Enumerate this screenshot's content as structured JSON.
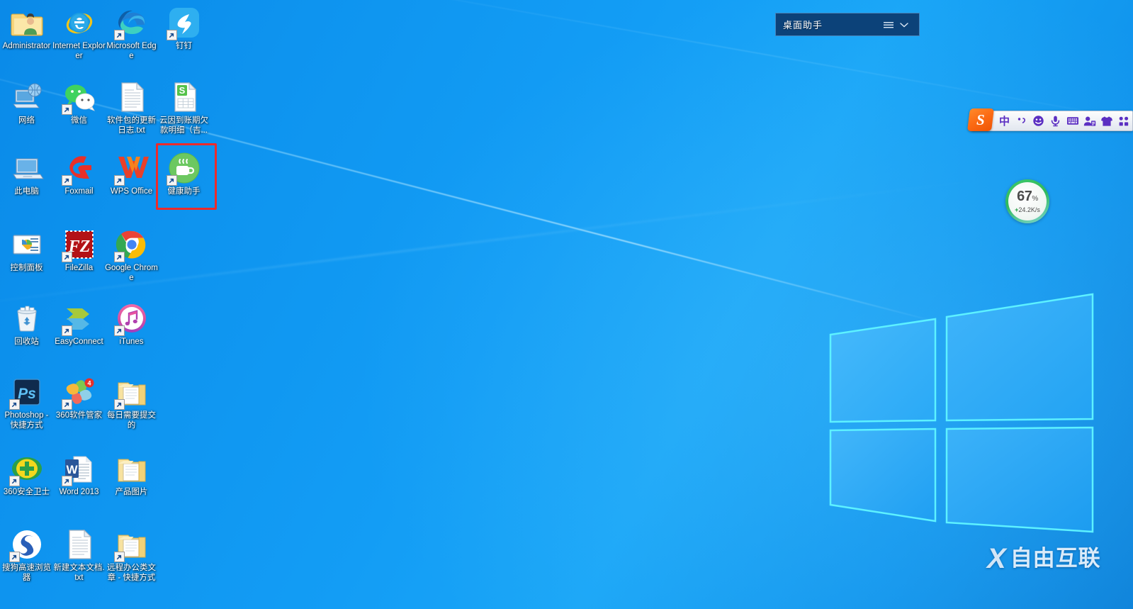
{
  "desktop": {
    "os": "Windows 10",
    "wallpaper_accent": "#1aa6f7",
    "background_color": "#0e94ef"
  },
  "icons": [
    {
      "label": "Administrator",
      "icon": "user-folder-icon",
      "shortcut": false,
      "col": 0,
      "row": 0
    },
    {
      "label": "Internet Explorer",
      "icon": "internet-explorer-icon",
      "shortcut": false,
      "col": 1,
      "row": 0
    },
    {
      "label": "Microsoft Edge",
      "icon": "microsoft-edge-icon",
      "shortcut": true,
      "col": 2,
      "row": 0
    },
    {
      "label": "钉钉",
      "icon": "dingtalk-icon",
      "shortcut": true,
      "col": 3,
      "row": 0
    },
    {
      "label": "网络",
      "icon": "network-icon",
      "shortcut": false,
      "col": 0,
      "row": 1
    },
    {
      "label": "微信",
      "icon": "wechat-icon",
      "shortcut": true,
      "col": 1,
      "row": 1
    },
    {
      "label": "软件包的更新日志.txt",
      "icon": "text-file-icon",
      "shortcut": false,
      "col": 2,
      "row": 1
    },
    {
      "label": "云因到账期欠款明细（吉...",
      "icon": "wps-spreadsheet-icon",
      "shortcut": false,
      "col": 3,
      "row": 1
    },
    {
      "label": "此电脑",
      "icon": "this-pc-icon",
      "shortcut": false,
      "col": 0,
      "row": 2
    },
    {
      "label": "Foxmail",
      "icon": "foxmail-icon",
      "shortcut": true,
      "col": 1,
      "row": 2
    },
    {
      "label": "WPS Office",
      "icon": "wps-office-icon",
      "shortcut": true,
      "col": 2,
      "row": 2
    },
    {
      "label": "健康助手",
      "icon": "health-assistant-icon",
      "shortcut": true,
      "col": 3,
      "row": 2,
      "highlighted": true
    },
    {
      "label": "控制面板",
      "icon": "control-panel-icon",
      "shortcut": false,
      "col": 0,
      "row": 3
    },
    {
      "label": "FileZilla",
      "icon": "filezilla-icon",
      "shortcut": true,
      "col": 1,
      "row": 3
    },
    {
      "label": "Google Chrome",
      "icon": "google-chrome-icon",
      "shortcut": true,
      "col": 2,
      "row": 3
    },
    {
      "label": "回收站",
      "icon": "recycle-bin-icon",
      "shortcut": false,
      "col": 0,
      "row": 4
    },
    {
      "label": "EasyConnect",
      "icon": "easyconnect-icon",
      "shortcut": true,
      "col": 1,
      "row": 4
    },
    {
      "label": "iTunes",
      "icon": "itunes-icon",
      "shortcut": true,
      "col": 2,
      "row": 4
    },
    {
      "label": "Photoshop - 快捷方式",
      "icon": "photoshop-icon",
      "shortcut": true,
      "col": 0,
      "row": 5
    },
    {
      "label": "360软件管家",
      "icon": "360-software-manager-icon",
      "shortcut": true,
      "col": 1,
      "row": 5,
      "badge": "4"
    },
    {
      "label": "每日需要提交的",
      "icon": "folder-icon",
      "shortcut": true,
      "col": 2,
      "row": 5
    },
    {
      "label": "360安全卫士",
      "icon": "360-safeguard-icon",
      "shortcut": true,
      "col": 0,
      "row": 6
    },
    {
      "label": "Word 2013",
      "icon": "microsoft-word-icon",
      "shortcut": true,
      "col": 1,
      "row": 6
    },
    {
      "label": "产品图片",
      "icon": "folder-icon",
      "shortcut": false,
      "col": 2,
      "row": 6
    },
    {
      "label": "搜狗高速浏览器",
      "icon": "sogou-browser-icon",
      "shortcut": true,
      "col": 0,
      "row": 7
    },
    {
      "label": "新建文本文档.txt",
      "icon": "text-file-icon",
      "shortcut": false,
      "col": 1,
      "row": 7
    },
    {
      "label": "远程办公类文章 - 快捷方式",
      "icon": "folder-icon",
      "shortcut": true,
      "col": 2,
      "row": 7
    }
  ],
  "desk_assistant": {
    "title": "桌面助手",
    "menu_icon": "hamburger-menu-icon",
    "collapse_icon": "chevron-down-icon"
  },
  "ime_toolbar": {
    "logo_letter": "S",
    "logo_name": "sogou-logo-icon",
    "items": [
      {
        "name": "input-mode-chinese",
        "label": "中",
        "type": "text"
      },
      {
        "name": "punctuation-toggle",
        "label": "，",
        "type": "text"
      },
      {
        "name": "emoji-icon",
        "label": "",
        "type": "icon"
      },
      {
        "name": "voice-input-icon",
        "label": "",
        "type": "icon"
      },
      {
        "name": "soft-keyboard-icon",
        "label": "",
        "type": "icon"
      },
      {
        "name": "user-account-icon",
        "label": "",
        "type": "icon"
      },
      {
        "name": "skin-theme-icon",
        "label": "",
        "type": "icon"
      },
      {
        "name": "toolbox-icon",
        "label": "",
        "type": "icon"
      }
    ]
  },
  "net_gauge": {
    "percent": "67",
    "percent_unit": "%",
    "speed": "24.2K/s",
    "speed_prefix": "+",
    "ring_color": "#35c363"
  },
  "watermark": {
    "logo": "X",
    "text": "自由互联"
  }
}
